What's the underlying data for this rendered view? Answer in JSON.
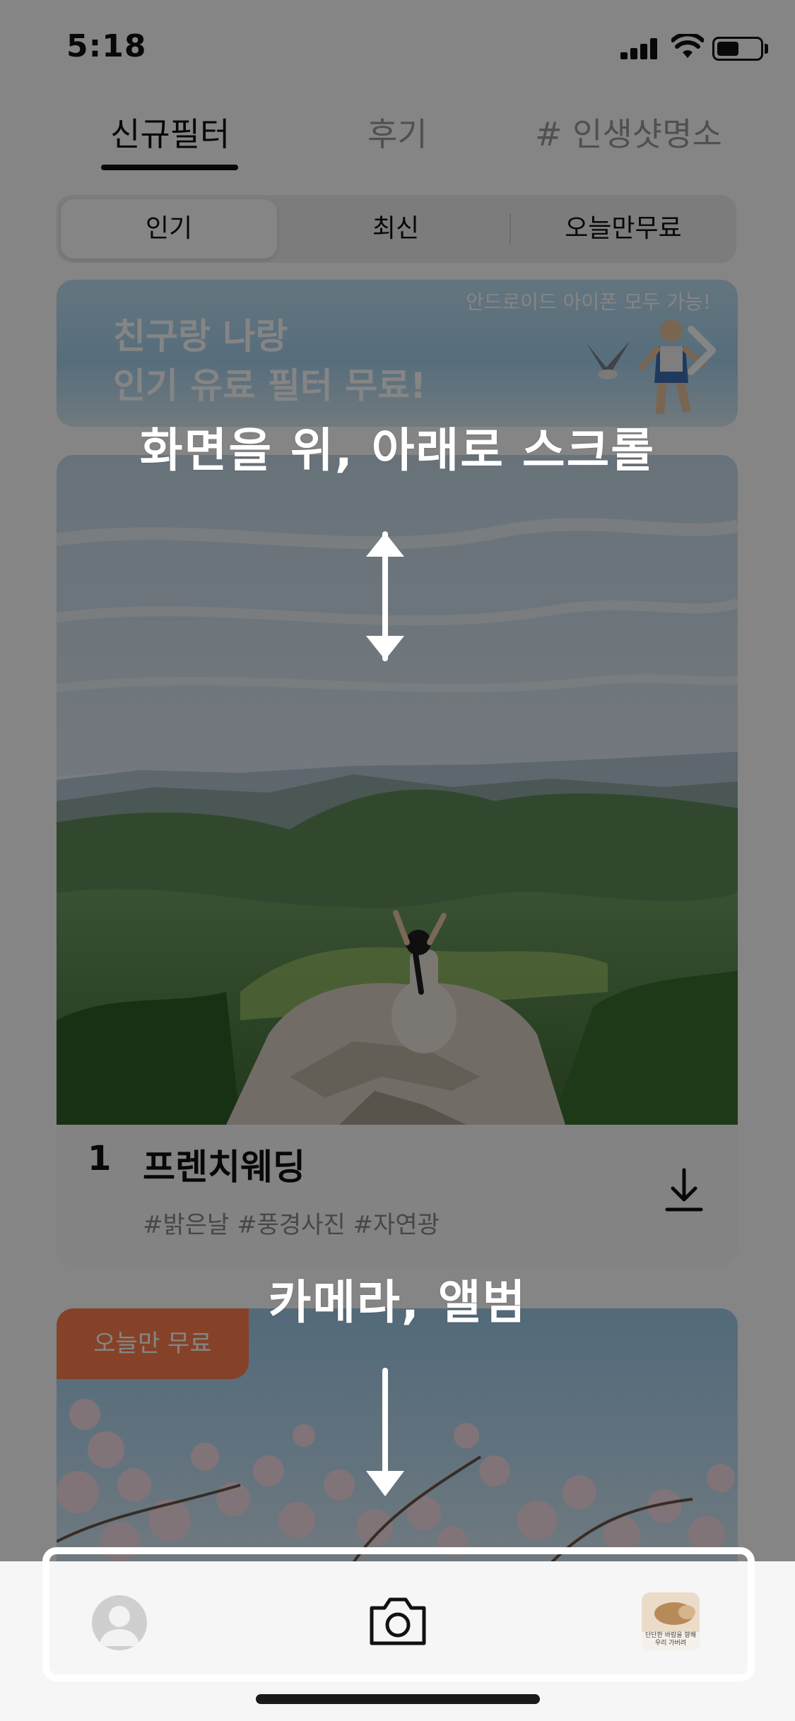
{
  "status_bar": {
    "time": "5:18"
  },
  "top_tabs": [
    {
      "label": "신규필터",
      "active": true
    },
    {
      "label": "후기",
      "active": false
    },
    {
      "label": "# 인생샷명소",
      "active": false
    }
  ],
  "segments": [
    {
      "label": "인기",
      "active": true
    },
    {
      "label": "최신",
      "active": false
    },
    {
      "label": "오늘만무료",
      "active": false
    }
  ],
  "banner": {
    "subtitle": "안드로이드 아이폰 모두 가능!",
    "line1": "친구랑 나랑",
    "line2": "인기 유료 필터 무료!"
  },
  "card": {
    "rank": "1",
    "title": "프렌치웨딩",
    "tags": "#밝은날 #풍경사진 #자연광"
  },
  "card2": {
    "badge": "오늘만 무료"
  },
  "bottom_nav": {
    "album_thumb_text": "단단한 바람을 향해 우리 가버려"
  },
  "annotations": {
    "scroll": "화면을 위, 아래로 스크롤",
    "camera_album": "카메라, 앨범"
  },
  "colors": {
    "badge": "#ff7f4e",
    "overlay": "rgba(0,0,0,0.48)",
    "annotation": "#ffffff"
  }
}
